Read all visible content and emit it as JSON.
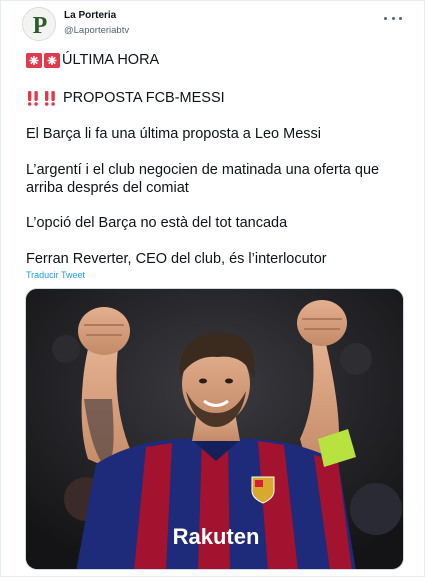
{
  "account": {
    "name": "La Porteria",
    "handle": "@Laporteriabtv",
    "avatar_letter": "P",
    "avatar_color": "#2e5b2c"
  },
  "tweet": {
    "line1": "ÚLTIMA HORA",
    "line2": "PROPOSTA FCB-MESSI",
    "para1": "El Barça li fa una última proposta a Leo Messi",
    "para2_a": "L’argentí i el club negocien de matinada una oferta que",
    "para2_b": "arriba després del comiat",
    "para3": "L’opció del Barça no està del tot tancada",
    "para4": "Ferran Reverter, CEO del club, és l’interlocutor",
    "translate_label": "Traducir Tweet"
  },
  "icons": {
    "more": "more-dots-icon",
    "siren": "police-siren-icon",
    "exclamation": "double-exclamation-icon"
  },
  "media": {
    "jersey_sponsor": "Rakuten",
    "description_colors": {
      "jersey_red": "#a3122e",
      "jersey_blue": "#1d2b7a",
      "armband": "#b7e23f"
    }
  },
  "colors": {
    "link": "#1d9bf0",
    "text": "#0f1419",
    "muted": "#536471",
    "emoji_red": "#e2394b"
  }
}
